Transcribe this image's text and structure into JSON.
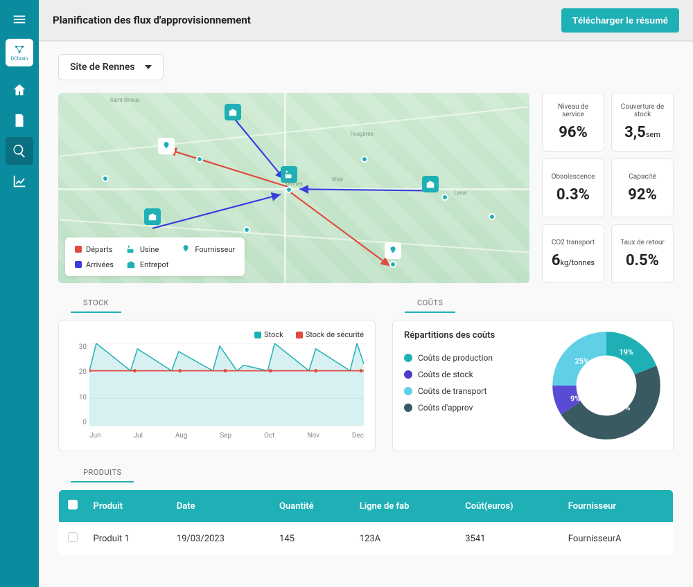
{
  "header": {
    "title": "Planification des flux d'approvisionnement",
    "download_label": "Télécharger le résumé"
  },
  "sidebar": {
    "logo_text": "DCbrain"
  },
  "site_selector": {
    "selected": "Site de Rennes"
  },
  "map_legend": {
    "departs": "Départs",
    "arrivees": "Arrivées",
    "usine": "Usine",
    "entrepot": "Entrepot",
    "fournisseur": "Fournisseur"
  },
  "map_places": {
    "rennes": "Rennes",
    "laval": "Laval",
    "saint_brieuc": "Saint-Brieuc",
    "fougeres": "Fougères",
    "vitre": "Vitré"
  },
  "kpis": [
    {
      "label": "Niveau de service",
      "value": "96%",
      "unit": ""
    },
    {
      "label": "Couverture de stock",
      "value": "3,5",
      "unit": "sem"
    },
    {
      "label": "Obsolescence",
      "value": "0.3%",
      "unit": ""
    },
    {
      "label": "Capacité",
      "value": "92%",
      "unit": ""
    },
    {
      "label": "CO2 transport",
      "value": "6",
      "unit": "kg/tonnes"
    },
    {
      "label": "Taux de retour",
      "value": "0.5%",
      "unit": ""
    }
  ],
  "sections": {
    "stock": "STOCK",
    "costs": "COÛTS",
    "products": "PRODUITS"
  },
  "stock_chart": {
    "legend_stock": "Stock",
    "legend_security": "Stock de sécurité"
  },
  "costs": {
    "title": "Répartitions des coûts",
    "items": [
      {
        "label": "Coûts de production",
        "color": "#1fb0b6"
      },
      {
        "label": "Coûts de stock",
        "color": "#4a3cc8"
      },
      {
        "label": "Coûts de transport",
        "color": "#5fd0e5"
      },
      {
        "label": "Coûts d'approv",
        "color": "#3a5a62"
      }
    ]
  },
  "products": {
    "headers": {
      "product": "Produit",
      "date": "Date",
      "quantity": "Quantité",
      "line": "Ligne de fab",
      "cost": "Coût(euros)",
      "supplier": "Fournisseur"
    },
    "rows": [
      {
        "product": "Produit 1",
        "date": "19/03/2023",
        "quantity": "145",
        "line": "123A",
        "cost": "3541",
        "supplier": "FournisseurA"
      }
    ]
  },
  "chart_data": [
    {
      "type": "line",
      "title": "Stock",
      "xlabel": "",
      "ylabel": "",
      "ylim": [
        0,
        30
      ],
      "categories": [
        "Jun",
        "Jul",
        "Aug",
        "Sep",
        "Oct",
        "Nov",
        "Dec"
      ],
      "series": [
        {
          "name": "Stock",
          "values_sawtooth_peaks": [
            30,
            28,
            27,
            29,
            22,
            30,
            28,
            30
          ],
          "values_sawtooth_troughs": [
            20,
            20,
            20,
            20,
            20,
            20,
            20,
            20
          ],
          "color": "#1fb0b6"
        },
        {
          "name": "Stock de sécurité",
          "values": [
            20,
            20,
            20,
            20,
            20,
            20,
            20
          ],
          "color": "#e04a3f"
        }
      ]
    },
    {
      "type": "pie",
      "title": "Répartitions des coûts",
      "series": [
        {
          "name": "Coûts de production",
          "value": 19,
          "color": "#1fb0b6"
        },
        {
          "name": "Coûts d'approv",
          "value": 47,
          "color": "#3a5a62"
        },
        {
          "name": "Coûts de stock",
          "value": 9,
          "color": "#5a4bd4"
        },
        {
          "name": "Coûts de transport",
          "value": 25,
          "color": "#5fd0e5"
        }
      ],
      "labels": [
        "19%",
        "47%",
        "9%",
        "25%"
      ]
    }
  ]
}
